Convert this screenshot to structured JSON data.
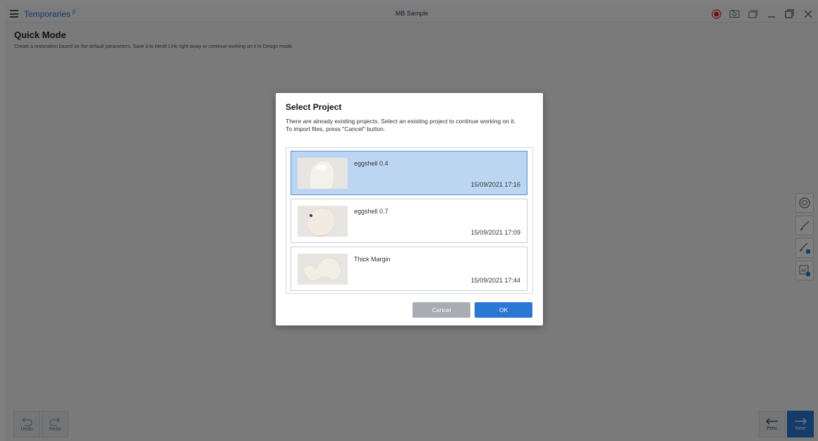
{
  "app": {
    "title": "Temporaries",
    "title_badge": "β",
    "document_title": "MB Sample"
  },
  "page": {
    "title": "Quick Mode",
    "subtitle": "Create a restoration based on the default parameters. Save it to Medit Link right away or continue working on it in Design mode."
  },
  "toolbar": {
    "undo_label": "Undo",
    "redo_label": "Redo",
    "prev_label": "Prev.",
    "next_label": "Next"
  },
  "right_tools": [
    "tooth-view-icon",
    "brush-icon",
    "brush-settings-icon",
    "all-teeth-icon"
  ],
  "dialog": {
    "title": "Select Project",
    "message_line1": "There are already existing projects. Select an existing project to continue working on it.",
    "message_line2": "To import files, press \"Cancel\" button.",
    "projects": [
      {
        "name": "eggshell 0.4",
        "date": "15/09/2021 17:16",
        "selected": true
      },
      {
        "name": "eggshell 0.7",
        "date": "15/09/2021 17:09",
        "selected": false
      },
      {
        "name": "Thick Margin",
        "date": "15/09/2021 17:44",
        "selected": false
      }
    ],
    "cancel_label": "Cancel",
    "ok_label": "OK"
  },
  "colors": {
    "accent": "#2a77d4",
    "selected_item": "#bcd6f2",
    "record": "#e02020"
  }
}
